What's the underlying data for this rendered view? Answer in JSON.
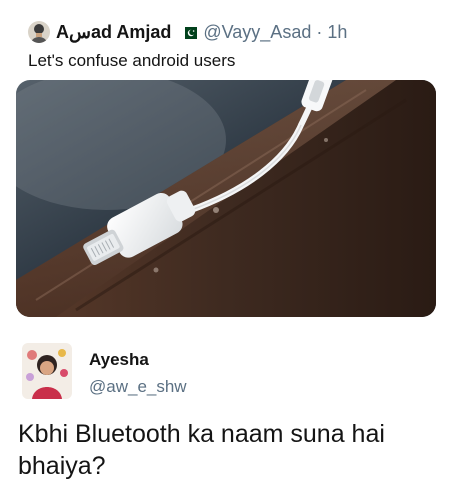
{
  "tweet": {
    "display_name": "Aسad Amjad",
    "handle": "@Vayy_Asad",
    "separator": "·",
    "time": "1h",
    "text": "Let's confuse android users",
    "badge_icon": "pakistan-flag-icon",
    "media_description_icon": "lightning-headphone-adapter-image"
  },
  "reply": {
    "display_name": "Ayesha",
    "handle": "@aw_e_shw",
    "text": "Kbhi Bluetooth ka naam suna hai bhaiya?"
  },
  "colors": {
    "text_primary": "#141414",
    "text_secondary": "#5b7083",
    "flag_green": "#01411c",
    "wood": "#4a2f22",
    "background_dark": "#1d2630"
  }
}
